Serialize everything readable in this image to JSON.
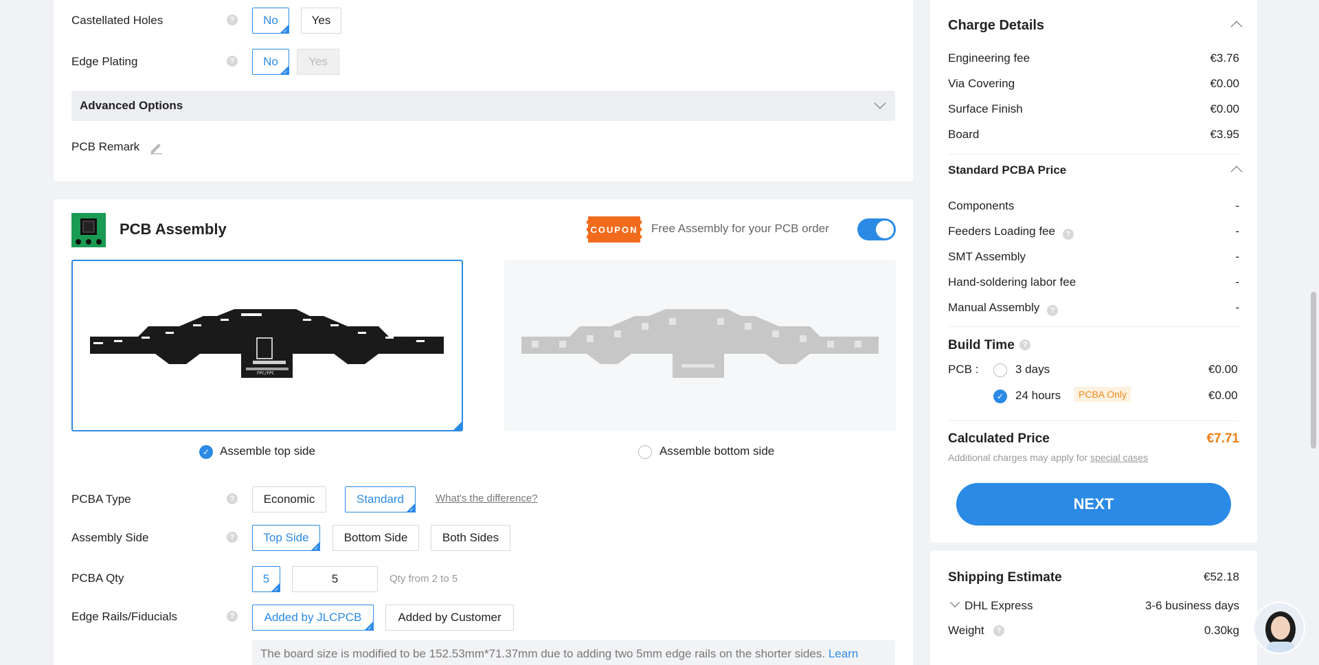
{
  "pcb_options": {
    "castellated": {
      "label": "Castellated Holes",
      "no": "No",
      "yes": "Yes"
    },
    "edge_plating": {
      "label": "Edge Plating",
      "no": "No",
      "yes": "Yes"
    },
    "advanced_options": "Advanced Options",
    "pcb_remark": "PCB Remark"
  },
  "assembly": {
    "title": "PCB Assembly",
    "coupon_badge": "COUPON",
    "coupon_text": "Free Assembly for your PCB order",
    "top_side_label": "Assemble top side",
    "bottom_side_label": "Assemble bottom side",
    "board_top_texts": [
      "FPC/FPC"
    ],
    "pcba_type": {
      "label": "PCBA Type",
      "options": [
        "Economic",
        "Standard"
      ],
      "selected": "Standard",
      "link": "What's the difference?"
    },
    "assembly_side": {
      "label": "Assembly Side",
      "options": [
        "Top Side",
        "Bottom Side",
        "Both Sides"
      ],
      "selected": "Top Side"
    },
    "pcba_qty": {
      "label": "PCBA Qty",
      "selected": "5",
      "input_value": "5",
      "hint": "Qty from 2 to 5"
    },
    "edge_rails": {
      "label": "Edge Rails/Fiducials",
      "options": [
        "Added by JLCPCB",
        "Added by Customer"
      ],
      "selected": "Added by JLCPCB"
    },
    "notice": "The board size is modified to be 152.53mm*71.37mm due to adding two 5mm edge rails on the shorter sides.",
    "notice_link": "Learn"
  },
  "charge_details": {
    "title": "Charge Details",
    "items": [
      {
        "name": "Engineering fee",
        "value": "€3.76"
      },
      {
        "name": "Via Covering",
        "value": "€0.00"
      },
      {
        "name": "Surface Finish",
        "value": "€0.00"
      },
      {
        "name": "Board",
        "value": "€3.95"
      }
    ],
    "pcba_title": "Standard PCBA Price",
    "pcba_items": [
      {
        "name": "Components",
        "value": "-"
      },
      {
        "name": "Feeders Loading fee",
        "value": "-"
      },
      {
        "name": "SMT Assembly",
        "value": "-"
      },
      {
        "name": "Hand-soldering labor fee",
        "value": "-"
      },
      {
        "name": "Manual Assembly",
        "value": "-"
      }
    ],
    "build_time": {
      "title": "Build Time",
      "pcb_label": "PCB :",
      "options": [
        {
          "label": "3 days",
          "price": "€0.00",
          "selected": false
        },
        {
          "label": "24 hours",
          "price": "€0.00",
          "selected": true,
          "badge": "PCBA Only"
        }
      ]
    },
    "calculated_price_label": "Calculated Price",
    "calculated_price": "€7.71",
    "note_prefix": "Additional charges may apply for",
    "note_link": "special cases",
    "next_button": "NEXT"
  },
  "shipping": {
    "title": "Shipping Estimate",
    "price": "€52.18",
    "method": "DHL Express",
    "days": "3-6 business days",
    "weight_label": "Weight",
    "weight": "0.30kg"
  },
  "colors": {
    "accent": "#2b8ae6",
    "price": "#f07d14",
    "coupon": "#f26b1d"
  }
}
